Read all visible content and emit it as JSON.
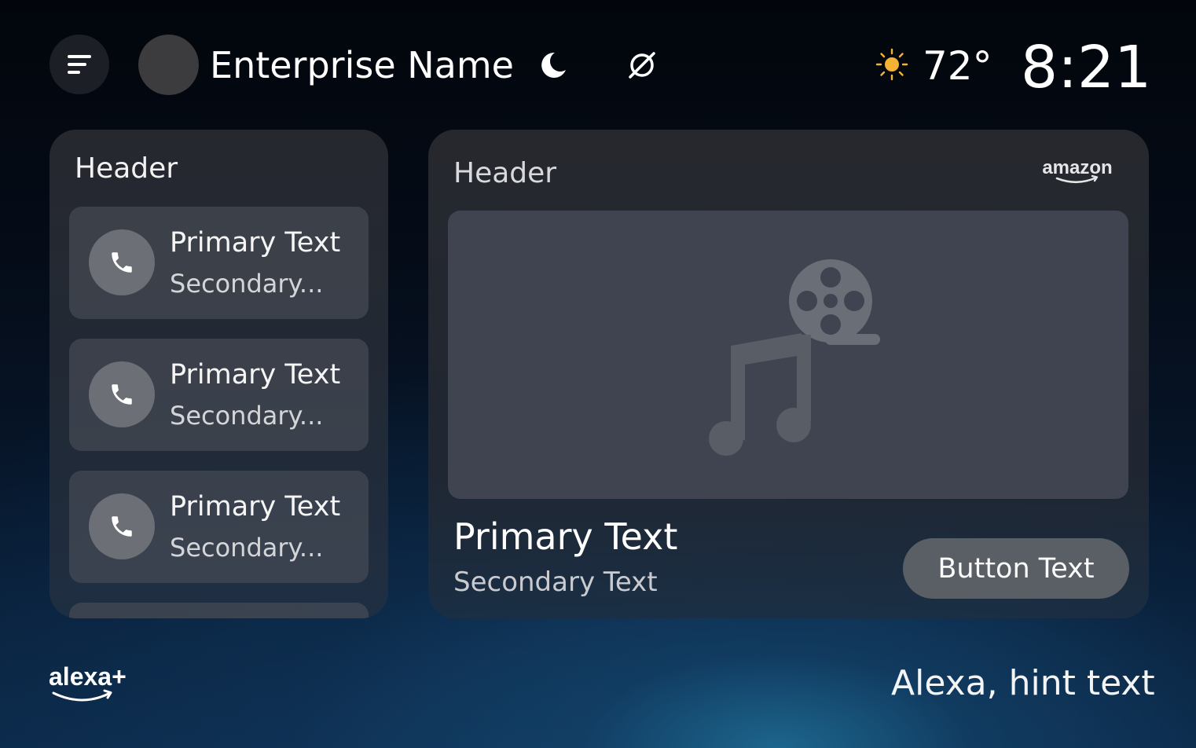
{
  "header": {
    "enterprise_name": "Enterprise Name",
    "temperature": "72°",
    "time": "8:21",
    "icons": [
      "menu-icon",
      "moon-icon",
      "do-not-disturb-icon",
      "sun-icon"
    ]
  },
  "left_card": {
    "header": "Header",
    "items": [
      {
        "primary": "Primary Text",
        "secondary": "Secondary...",
        "icon": "phone-icon"
      },
      {
        "primary": "Primary Text",
        "secondary": "Secondary...",
        "icon": "phone-icon"
      },
      {
        "primary": "Primary Text",
        "secondary": "Secondary...",
        "icon": "phone-icon"
      }
    ]
  },
  "right_card": {
    "header": "Header",
    "brand_logo": "amazon",
    "media_placeholder_icon": "music-video-icon",
    "primary": "Primary Text",
    "secondary": "Secondary Text",
    "button_label": "Button Text"
  },
  "footer": {
    "logo": "alexa+",
    "hint": "Alexa, hint text"
  },
  "colors": {
    "sun": "#f5b335",
    "card_bg": "#2a2d33",
    "button_bg": "#5a5f66",
    "media_bg": "#3f4450"
  }
}
